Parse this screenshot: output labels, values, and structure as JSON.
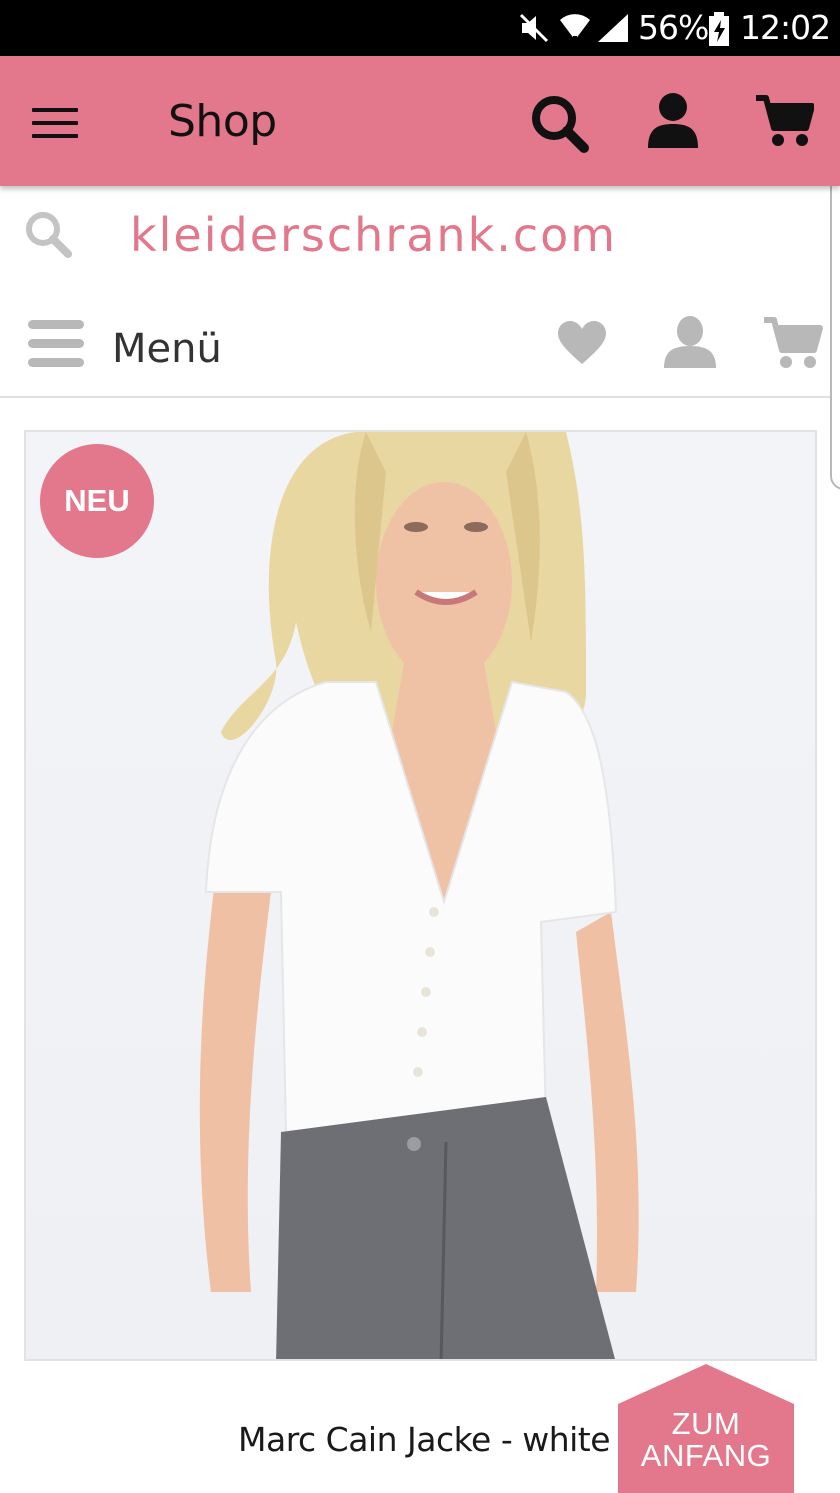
{
  "status_bar": {
    "battery": "56%",
    "time": "12:02",
    "icons": [
      "mute-icon",
      "wifi-icon",
      "signal-icon",
      "battery-charging-icon"
    ]
  },
  "app_bar": {
    "title": "Shop",
    "icons": [
      "menu-icon",
      "search-icon",
      "account-icon",
      "cart-icon"
    ],
    "background_color": "#e3778b"
  },
  "site": {
    "logo_text": "kleiderschrank.com",
    "brand_color": "#e3778b",
    "menu_label": "Menü",
    "nav_icons": [
      "heart-icon",
      "user-icon",
      "cart-icon"
    ]
  },
  "product": {
    "badge": "NEU",
    "name": "Marc Cain Jacke - white"
  },
  "back_to_top": {
    "line1": "ZUM",
    "line2": "ANFANG"
  }
}
